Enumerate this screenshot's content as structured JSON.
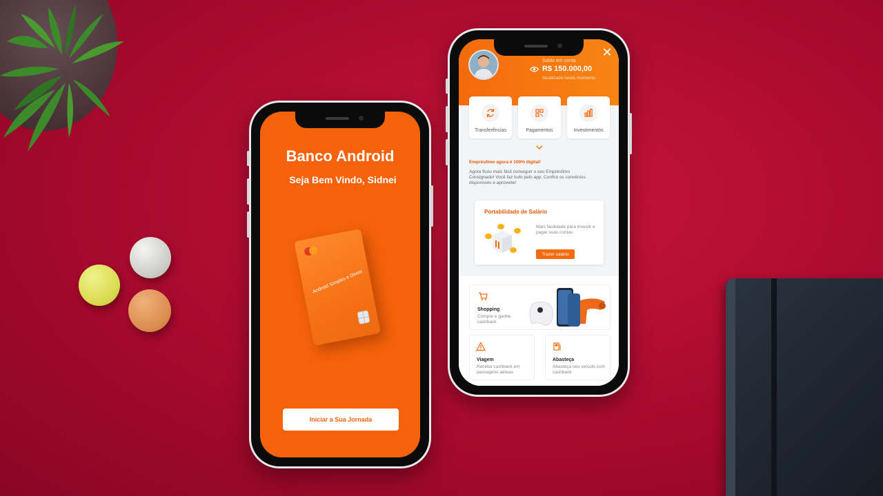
{
  "welcome_screen": {
    "bank_name": "Banco Android",
    "greeting": "Seja Bem Vindo,  Sidnei",
    "card_text": "Android Simples e Direto",
    "start_button": "Iniciar a Sua Jornada"
  },
  "home_screen": {
    "balance": {
      "label": "Saldo em conta",
      "value": "R$ 150.000,00",
      "updated": "Atualizado neste momento"
    },
    "quick_actions": [
      {
        "label": "Transferências",
        "icon": "refresh-icon"
      },
      {
        "label": "Pagamentos",
        "icon": "qr-code-icon"
      },
      {
        "label": "Investimentos",
        "icon": "bar-chart-icon"
      }
    ],
    "promo": {
      "title": "Empréstimo agora é 100% digital!",
      "text": "Agora ficou mais fácil conseguir o seu Empréstimo Consignado! Você faz tudo pelo app. Confira os convênios disponíveis e aproveite!"
    },
    "salary_card": {
      "title": "Portabilidade de Salário",
      "text": "Mais facilidade para investir e pagar suas contas",
      "button": "Trazer salário"
    },
    "shopping": {
      "title": "Shopping",
      "text": "Compre e ganhe cashback"
    },
    "tiles": [
      {
        "title": "Viagem",
        "text": "Receba cashback em passagens aéreas",
        "icon": "warning-triangle-icon"
      },
      {
        "title": "Abasteça",
        "text": "Abasteça seu veículo com cashback",
        "icon": "fuel-pump-icon"
      }
    ]
  },
  "colors": {
    "brand_orange": "#f5620a",
    "background_red": "#b5102f"
  }
}
